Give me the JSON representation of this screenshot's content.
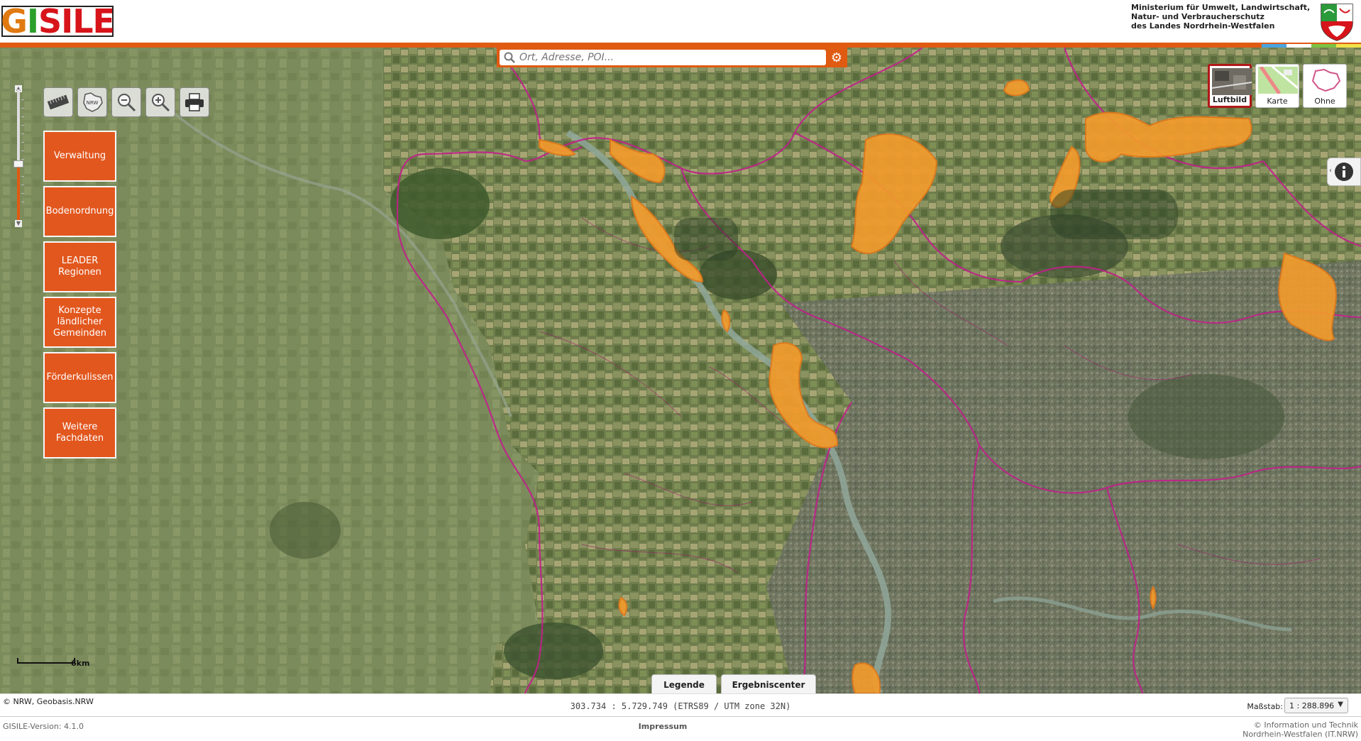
{
  "header": {
    "logo_text": "GISILE",
    "ministry_lines": [
      "Ministerium für Umwelt, Landwirtschaft,",
      "Natur- und Verbraucherschutz",
      "des Landes Nordrhein-Westfalen"
    ],
    "brand_orange": "#e05a12",
    "stripe_colors": [
      "#4aa3df",
      "#ffffff",
      "#7cc242",
      "#f0e14a"
    ]
  },
  "search": {
    "placeholder": "Ort, Adresse, POI...",
    "value": ""
  },
  "toolbar": {
    "tools": [
      {
        "name": "measure-icon"
      },
      {
        "name": "nrw-extent-icon"
      },
      {
        "name": "zoom-out-icon"
      },
      {
        "name": "zoom-in-icon"
      },
      {
        "name": "print-icon"
      }
    ]
  },
  "menu": {
    "items": [
      {
        "label": "Verwaltung"
      },
      {
        "label": "Bodenordnung"
      },
      {
        "label": "LEADER\nRegionen"
      },
      {
        "label": "Konzepte\nländlicher\nGemeinden"
      },
      {
        "label": "Förderkulissen"
      },
      {
        "label": "Weitere\nFachdaten"
      }
    ]
  },
  "basemaps": {
    "items": [
      {
        "label": "Luftbild",
        "active": true
      },
      {
        "label": "Karte",
        "active": false
      },
      {
        "label": "Ohne",
        "active": false
      }
    ]
  },
  "zoom": {
    "level_fraction": 0.44
  },
  "map": {
    "scale_label": "6km",
    "tabs": {
      "legend": "Legende",
      "results": "Ergebniscenter"
    }
  },
  "status": {
    "copyright": "© NRW, Geobasis.NRW",
    "coordinates": "303.734 : 5.729.749 (ETRS89 / UTM zone 32N)",
    "scale_label": "Maßstab:",
    "scale_value": "1 : 288.896"
  },
  "footer": {
    "version": "GISILE-Version: 4.1.0",
    "impressum": "Impressum",
    "it_line1": "© Information und Technik",
    "it_line2": "Nordrhein-Westfalen (IT.NRW)"
  }
}
